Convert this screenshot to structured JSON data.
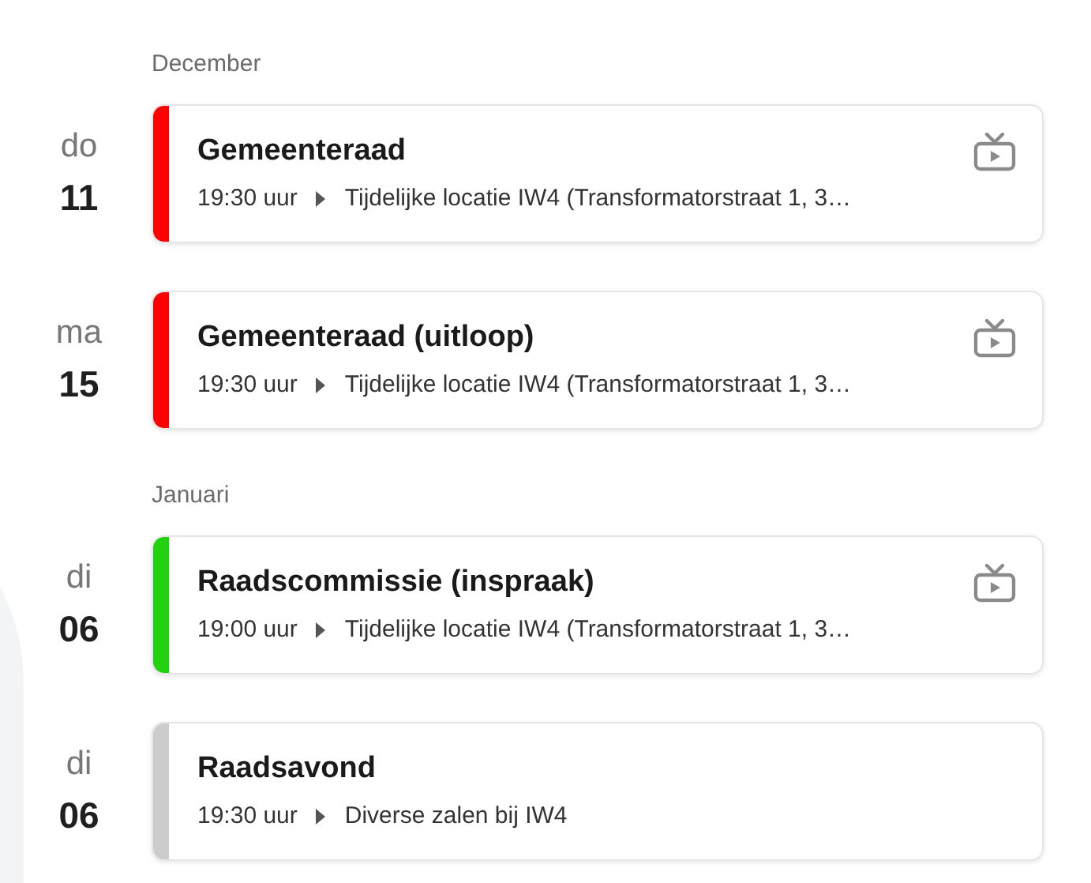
{
  "months": [
    {
      "name": "December",
      "events": [
        {
          "weekday": "do",
          "day": "11",
          "title": "Gemeenteraad",
          "time": "19:30 uur",
          "location": "Tijdelijke locatie IW4 (Transformatorstraat 1, 3…",
          "color": "#ff0000",
          "video": true
        },
        {
          "weekday": "ma",
          "day": "15",
          "title": "Gemeenteraad (uitloop)",
          "time": "19:30 uur",
          "location": "Tijdelijke locatie IW4 (Transformatorstraat 1, 3…",
          "color": "#ff0000",
          "video": true
        }
      ]
    },
    {
      "name": "Januari",
      "events": [
        {
          "weekday": "di",
          "day": "06",
          "title": "Raadscommissie (inspraak)",
          "time": "19:00 uur",
          "location": "Tijdelijke locatie IW4 (Transformatorstraat 1, 3…",
          "color": "#22d10f",
          "video": true
        },
        {
          "weekday": "di",
          "day": "06",
          "title": "Raadsavond",
          "time": "19:30 uur",
          "location": "Diverse zalen bij IW4",
          "color": "#cccccc",
          "video": false
        }
      ]
    }
  ]
}
